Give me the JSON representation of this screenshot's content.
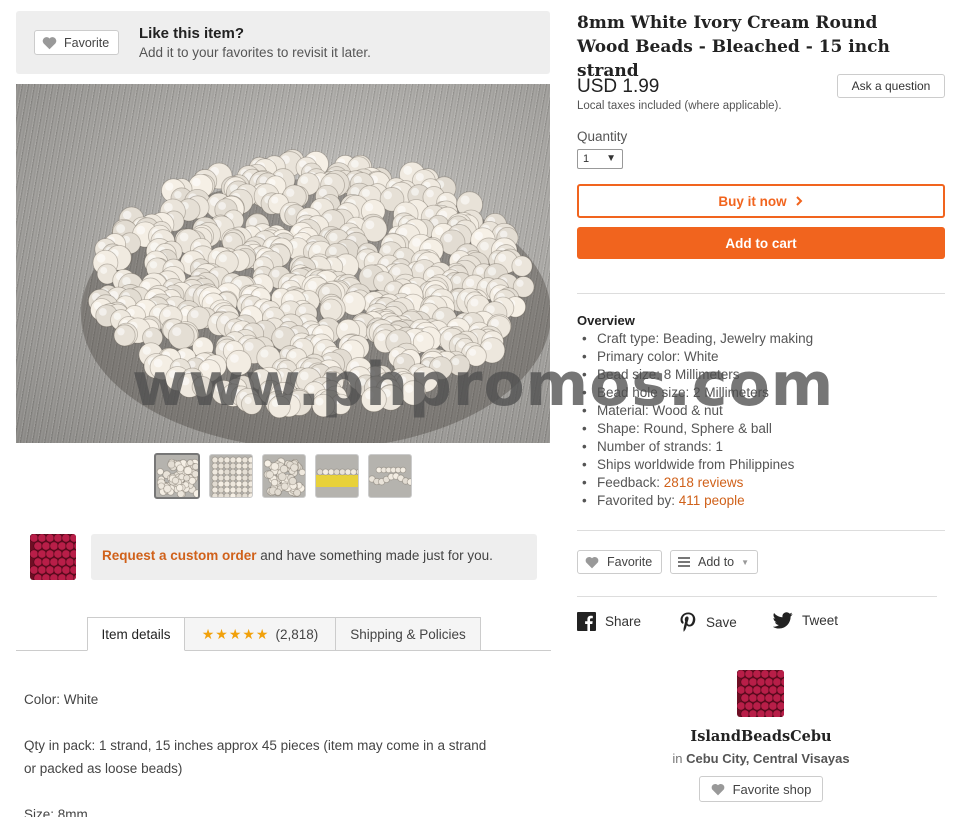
{
  "favorite_banner": {
    "button_label": "Favorite",
    "title": "Like this item?",
    "subtitle": "Add it to your favorites to revisit it later."
  },
  "product": {
    "title": "8mm White Ivory Cream Round Wood Beads - Bleached - 15 inch strand",
    "price": "USD 1.99",
    "tax_note": "Local taxes included (where applicable).",
    "ask_button": "Ask a question",
    "quantity_label": "Quantity",
    "quantity_value": "1",
    "buy_now_label": "Buy it now",
    "add_to_cart_label": "Add to cart"
  },
  "watermark": "www.phpromos.com",
  "thumbnails": [
    {
      "name": "thumbnail-1",
      "active": true
    },
    {
      "name": "thumbnail-2",
      "active": false
    },
    {
      "name": "thumbnail-3",
      "active": false
    },
    {
      "name": "thumbnail-4",
      "active": false
    },
    {
      "name": "thumbnail-5",
      "active": false
    }
  ],
  "custom_order": {
    "link": "Request a custom order",
    "text": " and have something made just for you."
  },
  "tabs": {
    "details": "Item details",
    "stars": "★★★★★",
    "reviews_count": "(2,818)",
    "shipping": "Shipping & Policies"
  },
  "description": {
    "color": "Color: White",
    "qty_line1": "Qty in pack: 1 strand, 15 inches approx 45 pieces (item may come in a strand",
    "qty_line2": "or packed as loose beads)",
    "size": "Size: 8mm"
  },
  "overview": {
    "title": "Overview",
    "items": [
      "Craft type: Beading, Jewelry making",
      "Primary color: White",
      "Bead size: 8 Millimeters",
      "Bead hole size: 2 Millimeters",
      "Material: Wood & nut",
      "Shape: Round, Sphere & ball",
      "Number of strands: 1",
      "Ships worldwide from Philippines"
    ],
    "feedback_label": "Feedback: ",
    "feedback_link": "2818 reviews",
    "favorited_label": "Favorited by: ",
    "favorited_link": "411 people"
  },
  "actions": {
    "favorite": "Favorite",
    "add_to": "Add to"
  },
  "share": {
    "facebook": "Share",
    "pinterest": "Save",
    "twitter": "Tweet"
  },
  "shop": {
    "name": "IslandBeadsCebu",
    "location_prefix": "in ",
    "location": "Cebu City, Central Visayas",
    "favorite_shop": "Favorite shop"
  },
  "colors": {
    "accent": "#f1641e",
    "link": "#d0611a",
    "star": "#f1a10b",
    "shop_avatar": "#b81e48"
  }
}
